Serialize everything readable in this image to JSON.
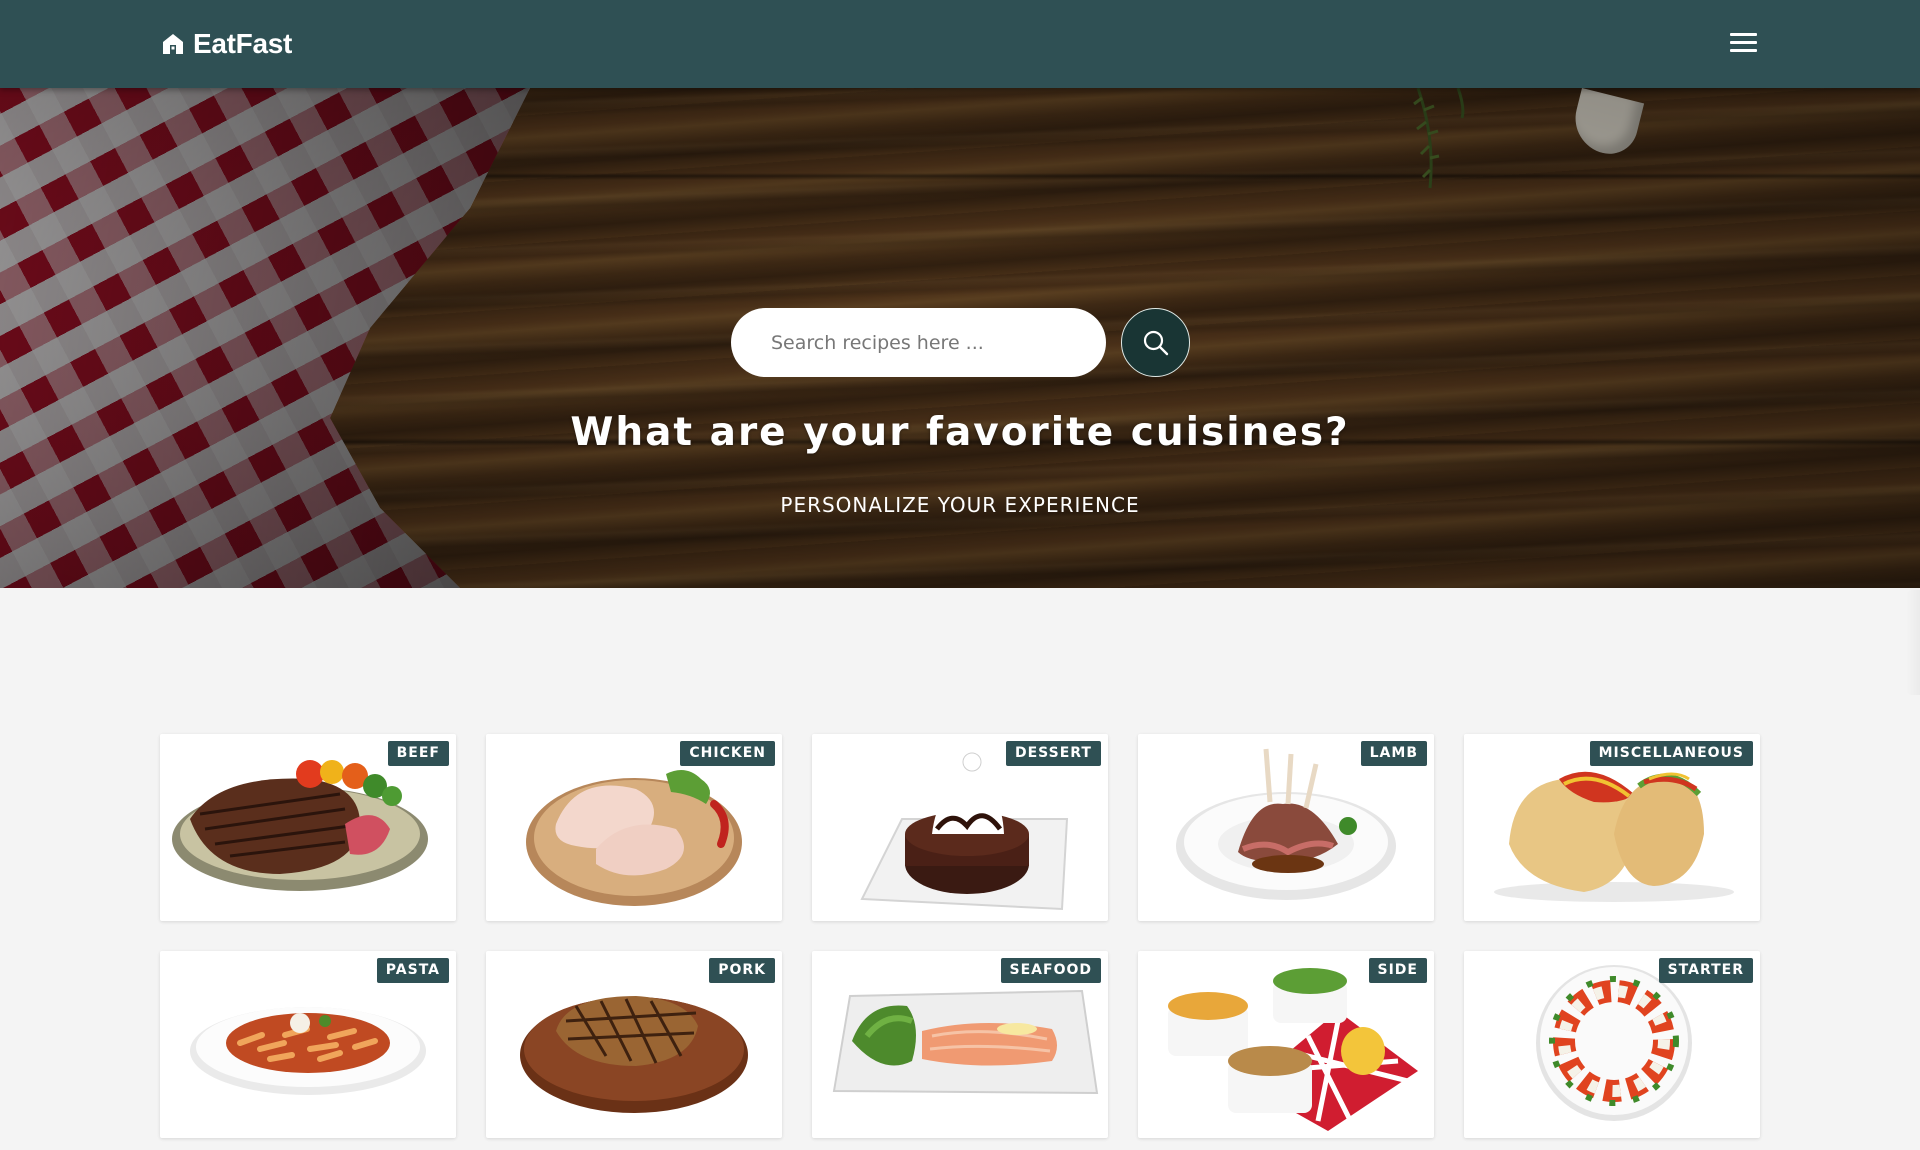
{
  "brand": {
    "name": "EatFast",
    "icon": "home-icon"
  },
  "nav": {
    "menu_icon": "hamburger-menu-icon"
  },
  "hero": {
    "search_placeholder": "Search recipes here ...",
    "search_value": "",
    "search_icon": "search-icon",
    "title": "What are your favorite cuisines?",
    "subtitle": "PERSONALIZE YOUR EXPERIENCE"
  },
  "categories": [
    {
      "label": "BEEF",
      "image": "steak-plate"
    },
    {
      "label": "CHICKEN",
      "image": "raw-chicken-legs"
    },
    {
      "label": "DESSERT",
      "image": "chocolate-lava-cake"
    },
    {
      "label": "LAMB",
      "image": "lamb-chops"
    },
    {
      "label": "MISCELLANEOUS",
      "image": "tacos"
    },
    {
      "label": "PASTA",
      "image": "penne-pasta"
    },
    {
      "label": "PORK",
      "image": "grilled-pork-chop"
    },
    {
      "label": "SEAFOOD",
      "image": "smoked-salmon"
    },
    {
      "label": "SIDE",
      "image": "side-dishes"
    },
    {
      "label": "STARTER",
      "image": "caprese-wreath"
    }
  ],
  "colors": {
    "navbar": "#2f5054",
    "badge": "#2f5054",
    "search_button": "#193534",
    "page_background": "#f4f4f4"
  }
}
